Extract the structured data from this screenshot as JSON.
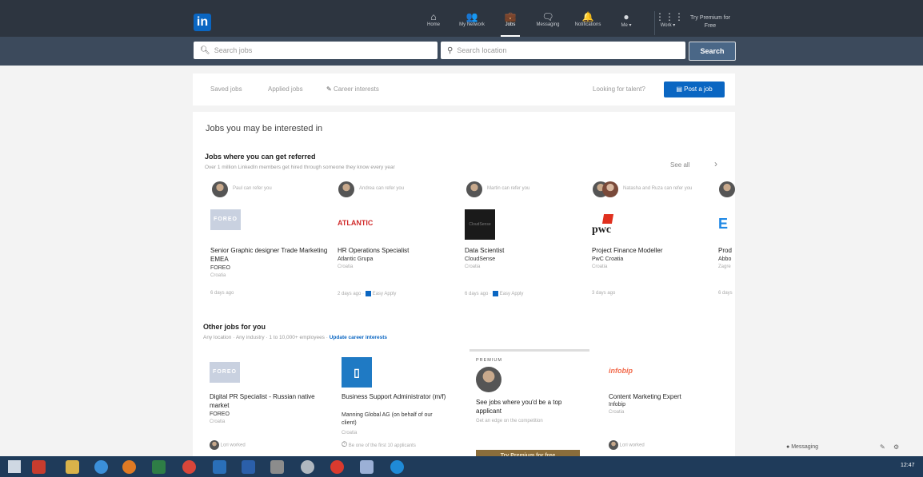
{
  "nav": {
    "logo": "in",
    "items": [
      {
        "id": "home",
        "label": "Home",
        "icon": "⌂"
      },
      {
        "id": "network",
        "label": "My Network",
        "icon": "👥"
      },
      {
        "id": "jobs",
        "label": "Jobs",
        "icon": "💼"
      },
      {
        "id": "messaging",
        "label": "Messaging",
        "icon": "🗨"
      },
      {
        "id": "notifications",
        "label": "Notifications",
        "icon": "🔔"
      },
      {
        "id": "me",
        "label": "Me ▾",
        "icon": "●"
      },
      {
        "id": "work",
        "label": "Work ▾",
        "icon": "⋮⋮⋮"
      }
    ],
    "premium": "Try Premium for Free"
  },
  "search": {
    "jobs_placeholder": "Search jobs",
    "location_placeholder": "Search location",
    "button": "Search"
  },
  "tabs": {
    "saved": "Saved jobs",
    "applied": "Applied jobs",
    "career": "Career interests",
    "talent": "Looking for talent?",
    "post": "Post a job"
  },
  "main": {
    "heading": "Jobs you may be interested in",
    "referred": {
      "title": "Jobs where you can get referred",
      "subtitle": "Over 1 million LinkedIn members get hired through someone they know every year",
      "see_all": "See all",
      "jobs": [
        {
          "referrer": "Paul can refer you",
          "logo": "FOREO",
          "title": "Senior Graphic designer Trade Marketing EMEA",
          "company": "FOREO",
          "location": "Croatia",
          "meta": "6 days ago",
          "easy": ""
        },
        {
          "referrer": "Andrea can refer you",
          "logo": "ATLANTIC",
          "title": "HR Operations Specialist",
          "company": "Atlantic Grupa",
          "location": "Croatia",
          "meta": "2 days ago ·",
          "easy": "Easy Apply"
        },
        {
          "referrer": "Martin can refer you",
          "logo": "CloudSense",
          "title": "Data Scientist",
          "company": "CloudSense",
          "location": "Croatia",
          "meta": "6 days ago ·",
          "easy": "Easy Apply"
        },
        {
          "referrer": "Natasha and Ruza can refer you",
          "logo": "pwc",
          "title": "Project Finance Modeller",
          "company": "PwC Croatia",
          "location": "Croatia",
          "meta": "3 days ago",
          "easy": ""
        },
        {
          "referrer": "",
          "logo": "E",
          "title": "Prod",
          "company": "Abbo",
          "location": "Zagre",
          "meta": "6 days",
          "easy": ""
        }
      ]
    },
    "other": {
      "title": "Other jobs for you",
      "filters": "Any location · Any industry · 1 to 10,000+ employees ·",
      "update": "Update career interests",
      "jobs": [
        {
          "logo": "FOREO",
          "title": "Digital PR Specialist - Russian native market",
          "company": "FOREO",
          "location": "Croatia",
          "meta": "Lori worked"
        },
        {
          "logo": "▯",
          "title": "Business Support Administrator (m/f)",
          "company": "Manning Global AG (on behalf of our client)",
          "location": "Croatia",
          "meta": "Be one of the first 10 applicants"
        },
        {
          "logo": "infobip",
          "title": "Content Marketing Expert",
          "company": "Infobip",
          "location": "Croatia",
          "meta": "Lori worked"
        }
      ],
      "premium": {
        "tag": "PREMIUM",
        "title": "See jobs where you'd be a top applicant",
        "sub": "Get an edge on the competition",
        "button": "Try Premium for free"
      }
    }
  },
  "footer": {
    "messaging": "Messaging"
  },
  "taskbar": {
    "time": "12:47"
  },
  "colors": {
    "brand": "#0a66c2",
    "nav_bg": "#2d3540",
    "search_bg": "#3c4a5c",
    "premium_gold": "#8a6d3b"
  }
}
